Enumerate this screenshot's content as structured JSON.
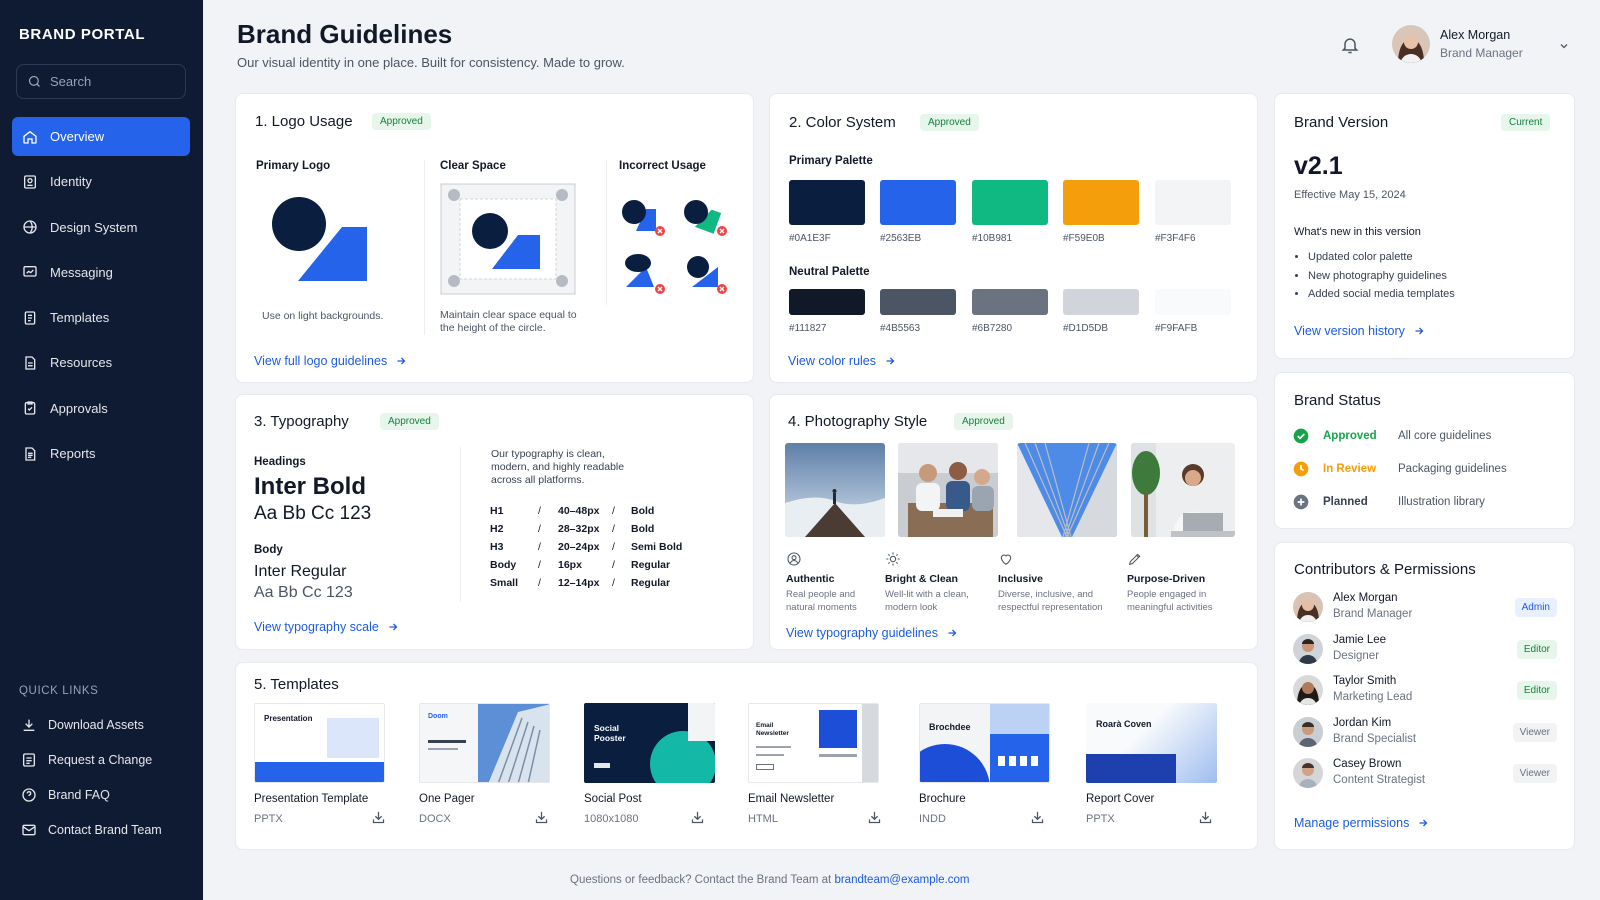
{
  "sidebar": {
    "brand": "BRAND PORTAL",
    "search_placeholder": "Search",
    "items": [
      {
        "label": "Overview",
        "icon": "home-icon",
        "active": true
      },
      {
        "label": "Identity",
        "icon": "identity-icon"
      },
      {
        "label": "Design System",
        "icon": "globe-icon"
      },
      {
        "label": "Messaging",
        "icon": "message-icon"
      },
      {
        "label": "Templates",
        "icon": "template-icon"
      },
      {
        "label": "Resources",
        "icon": "resources-icon"
      },
      {
        "label": "Approvals",
        "icon": "approvals-icon"
      },
      {
        "label": "Reports",
        "icon": "reports-icon"
      }
    ],
    "quick_links_title": "QUICK LINKS",
    "quick_links": [
      {
        "label": "Download Assets",
        "icon": "download-icon"
      },
      {
        "label": "Request a Change",
        "icon": "request-icon"
      },
      {
        "label": "Brand FAQ",
        "icon": "help-icon"
      },
      {
        "label": "Contact Brand Team",
        "icon": "mail-icon"
      }
    ]
  },
  "header": {
    "title": "Brand Guidelines",
    "subtitle": "Our visual identity in one place. Built for consistency. Made to grow.",
    "user": {
      "name": "Alex Morgan",
      "role": "Brand Manager"
    }
  },
  "logo_usage": {
    "title": "1. Logo Usage",
    "badge": "Approved",
    "primary_label": "Primary Logo",
    "primary_note": "Use on light backgrounds.",
    "clear_label": "Clear Space",
    "clear_note": "Maintain clear space equal to the height of the circle.",
    "incorrect_label": "Incorrect Usage",
    "link": "View full logo guidelines"
  },
  "color_system": {
    "title": "2. Color System",
    "badge": "Approved",
    "primary_label": "Primary Palette",
    "primary": [
      "#0A1E3F",
      "#2563EB",
      "#10B981",
      "#F59E0B",
      "#F3F4F6"
    ],
    "neutral_label": "Neutral Palette",
    "neutral": [
      "#111827",
      "#4B5563",
      "#6B7280",
      "#D1D5DB",
      "#F9FAFB"
    ],
    "link": "View color rules"
  },
  "brand_version": {
    "title": "Brand Version",
    "badge": "Current",
    "version": "v2.1",
    "effective": "Effective May 15, 2024",
    "whats_new_title": "What's new in this version",
    "changes": [
      "Updated color palette",
      "New photography guidelines",
      "Added social media templates"
    ],
    "link": "View version history"
  },
  "typography": {
    "title": "3. Typography",
    "badge": "Approved",
    "headings_label": "Headings",
    "heading_font": "Inter Bold",
    "heading_sample": "Aa Bb Cc 123",
    "body_label": "Body",
    "body_font": "Inter Regular",
    "body_sample": "Aa Bb Cc 123",
    "description": "Our typography is clean, modern, and highly readable across all platforms.",
    "scale": [
      {
        "level": "H1",
        "size": "40–48px",
        "weight": "Bold"
      },
      {
        "level": "H2",
        "size": "28–32px",
        "weight": "Bold"
      },
      {
        "level": "H3",
        "size": "20–24px",
        "weight": "Semi Bold"
      },
      {
        "level": "Body",
        "size": "16px",
        "weight": "Regular"
      },
      {
        "level": "Small",
        "size": "12–14px",
        "weight": "Regular"
      }
    ],
    "separator": "/",
    "link": "View typography scale"
  },
  "photography": {
    "title": "4. Photography Style",
    "badge": "Approved",
    "traits": [
      {
        "title": "Authentic",
        "desc": "Real people and natural moments",
        "icon": "person-icon"
      },
      {
        "title": "Bright & Clean",
        "desc": "Well-lit with a clean, modern look",
        "icon": "sun-icon"
      },
      {
        "title": "Inclusive",
        "desc": "Diverse, inclusive, and respectful representation",
        "icon": "heart-icon"
      },
      {
        "title": "Purpose-Driven",
        "desc": "People engaged in meaningful activities",
        "icon": "pen-icon"
      }
    ],
    "link": "View typography guidelines"
  },
  "brand_status": {
    "title": "Brand Status",
    "items": [
      {
        "status": "Approved",
        "desc": "All core guidelines",
        "color": "#16a34a"
      },
      {
        "status": "In Review",
        "desc": "Packaging guidelines",
        "color": "#f59e0b"
      },
      {
        "status": "Planned",
        "desc": "Illustration library",
        "color": "#6b7280"
      }
    ]
  },
  "templates": {
    "title": "5. Templates",
    "items": [
      {
        "name": "Presentation Template",
        "type": "PPTX",
        "thumb_text": "Presentation"
      },
      {
        "name": "One Pager",
        "type": "DOCX",
        "thumb_text": "Doom"
      },
      {
        "name": "Social Post",
        "type": "1080x1080",
        "thumb_text": "Social Pooster"
      },
      {
        "name": "Email Newsletter",
        "type": "HTML",
        "thumb_text": "Email Newsletter"
      },
      {
        "name": "Brochure",
        "type": "INDD",
        "thumb_text": "Brochdee"
      },
      {
        "name": "Report Cover",
        "type": "PPTX",
        "thumb_text": "Roarà Coven"
      }
    ]
  },
  "contributors": {
    "title": "Contributors & Permissions",
    "people": [
      {
        "name": "Alex Morgan",
        "role": "Brand Manager",
        "permission": "Admin",
        "badge_bg": "#e8efff",
        "badge_fg": "#1d5ae0"
      },
      {
        "name": "Jamie Lee",
        "role": "Designer",
        "permission": "Editor",
        "badge_bg": "#e6f6ea",
        "badge_fg": "#17803d"
      },
      {
        "name": "Taylor Smith",
        "role": "Marketing Lead",
        "permission": "Editor",
        "badge_bg": "#e6f6ea",
        "badge_fg": "#17803d"
      },
      {
        "name": "Jordan Kim",
        "role": "Brand Specialist",
        "permission": "Viewer",
        "badge_bg": "#f1f3f5",
        "badge_fg": "#6b7280"
      },
      {
        "name": "Casey Brown",
        "role": "Content Strategist",
        "permission": "Viewer",
        "badge_bg": "#f1f3f5",
        "badge_fg": "#6b7280"
      }
    ],
    "link": "Manage permissions"
  },
  "footer": {
    "text": "Questions or feedback? Contact the Brand Team at",
    "email": "brandteam@example.com"
  }
}
